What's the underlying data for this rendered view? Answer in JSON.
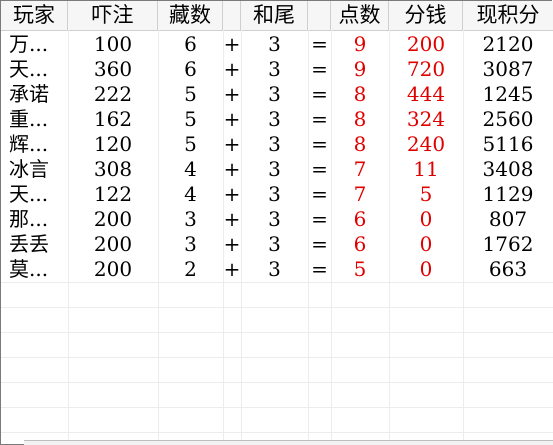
{
  "headers": [
    "玩家",
    "吓注",
    "藏数",
    "",
    "和尾",
    "",
    "点数",
    "分钱",
    "现积分"
  ],
  "rows": [
    {
      "player": "万...",
      "bet": "100",
      "hidden": "6",
      "plus": "+",
      "tail": "3",
      "eq": "=",
      "points": "9",
      "money": "200",
      "score": "2120"
    },
    {
      "player": "天...",
      "bet": "360",
      "hidden": "6",
      "plus": "+",
      "tail": "3",
      "eq": "=",
      "points": "9",
      "money": "720",
      "score": "3087"
    },
    {
      "player": "承诺",
      "bet": "222",
      "hidden": "5",
      "plus": "+",
      "tail": "3",
      "eq": "=",
      "points": "8",
      "money": "444",
      "score": "1245"
    },
    {
      "player": "重...",
      "bet": "162",
      "hidden": "5",
      "plus": "+",
      "tail": "3",
      "eq": "=",
      "points": "8",
      "money": "324",
      "score": "2560"
    },
    {
      "player": "辉...",
      "bet": "120",
      "hidden": "5",
      "plus": "+",
      "tail": "3",
      "eq": "=",
      "points": "8",
      "money": "240",
      "score": "5116"
    },
    {
      "player": "冰言",
      "bet": "308",
      "hidden": "4",
      "plus": "+",
      "tail": "3",
      "eq": "=",
      "points": "7",
      "money": "11",
      "score": "3408"
    },
    {
      "player": "天...",
      "bet": "122",
      "hidden": "4",
      "plus": "+",
      "tail": "3",
      "eq": "=",
      "points": "7",
      "money": "5",
      "score": "1129"
    },
    {
      "player": "那...",
      "bet": "200",
      "hidden": "3",
      "plus": "+",
      "tail": "3",
      "eq": "=",
      "points": "6",
      "money": "0",
      "score": "807"
    },
    {
      "player": "丢丢",
      "bet": "200",
      "hidden": "3",
      "plus": "+",
      "tail": "3",
      "eq": "=",
      "points": "6",
      "money": "0",
      "score": "1762"
    },
    {
      "player": "莫...",
      "bet": "200",
      "hidden": "2",
      "plus": "+",
      "tail": "3",
      "eq": "=",
      "points": "5",
      "money": "0",
      "score": "663"
    }
  ],
  "colors": {
    "highlight": "#e00000",
    "text": "#000000"
  }
}
